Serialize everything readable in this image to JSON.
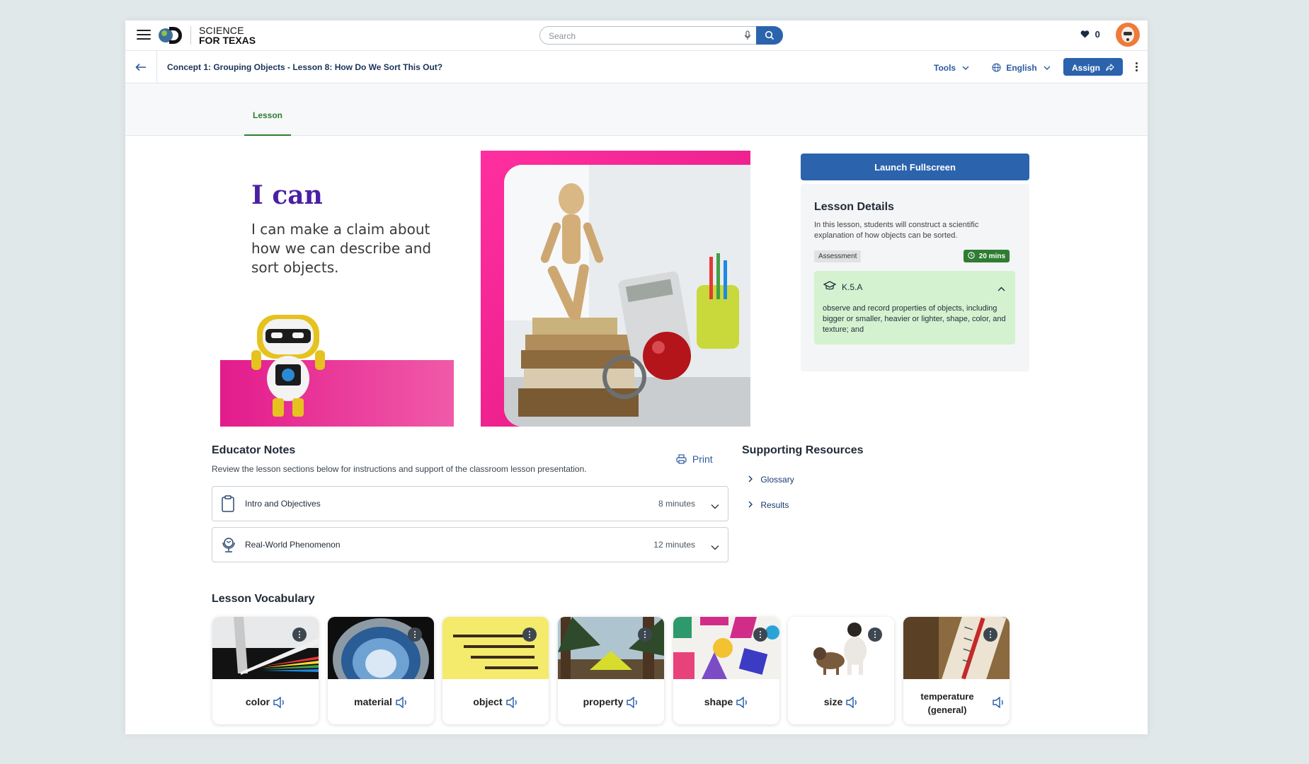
{
  "header": {
    "brand_line1": "SCIENCE",
    "brand_line2": "FOR TEXAS",
    "search_placeholder": "Search",
    "favorites_count": "0"
  },
  "subbar": {
    "breadcrumb": "Concept 1: Grouping Objects - Lesson 8: How Do We Sort This Out?",
    "tools_label": "Tools",
    "language_label": "English",
    "assign_label": "Assign"
  },
  "tabs": [
    {
      "label": "Lesson"
    }
  ],
  "hero": {
    "heading": "I can",
    "statement": "I can make a claim about how we can describe and sort objects."
  },
  "lesson_details": {
    "launch_label": "Launch Fullscreen",
    "title": "Lesson Details",
    "description": "In this lesson, students will construct a scientific explanation of how objects can be sorted.",
    "tag": "Assessment",
    "duration": "20 mins",
    "standard": {
      "code": "K.5.A",
      "text": "observe and record properties of objects, including bigger or smaller, heavier or lighter, shape, color, and texture; and"
    }
  },
  "educator_notes": {
    "title": "Educator Notes",
    "subtitle": "Review the lesson sections below for instructions and support of the classroom lesson presentation.",
    "print_label": "Print",
    "sections": [
      {
        "label": "Intro and Objectives",
        "minutes": "8 minutes",
        "icon": "clipboard-icon"
      },
      {
        "label": "Real-World Phenomenon",
        "minutes": "12 minutes",
        "icon": "globe-stand-icon"
      }
    ]
  },
  "supporting_resources": {
    "title": "Supporting Resources",
    "links": [
      {
        "label": "Glossary"
      },
      {
        "label": "Results"
      }
    ]
  },
  "vocabulary": {
    "title": "Lesson Vocabulary",
    "cards": [
      {
        "word": "color"
      },
      {
        "word": "material"
      },
      {
        "word": "object"
      },
      {
        "word": "property"
      },
      {
        "word": "shape"
      },
      {
        "word": "size"
      },
      {
        "word": "temperature (general)"
      }
    ]
  },
  "colors": {
    "primary_blue": "#2b63ad",
    "accent_green": "#2e7d32",
    "hero_pink": "#e31b8c",
    "heading_purple": "#4a1fa3"
  }
}
